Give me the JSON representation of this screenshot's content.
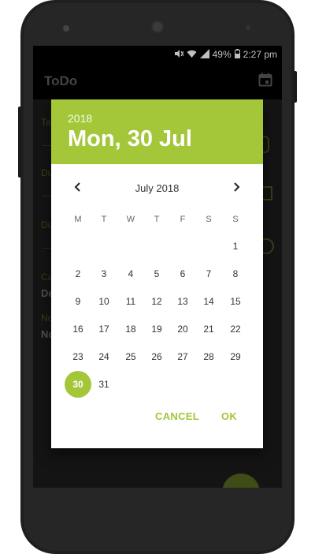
{
  "status_bar": {
    "battery": "49%",
    "time": "2:27 pm"
  },
  "app": {
    "title": "ToDo"
  },
  "background_form": {
    "labels": [
      "Ta",
      "Du",
      "Du",
      "Ca",
      "No"
    ],
    "values": [
      "De",
      "No"
    ]
  },
  "date_picker": {
    "accent_color": "#a4c639",
    "header": {
      "year": "2018",
      "date": "Mon, 30 Jul"
    },
    "month_label": "July 2018",
    "weekdays": [
      "M",
      "T",
      "W",
      "T",
      "F",
      "S",
      "S"
    ],
    "days": [
      "1",
      "2",
      "3",
      "4",
      "5",
      "6",
      "7",
      "8",
      "9",
      "10",
      "11",
      "12",
      "13",
      "14",
      "15",
      "16",
      "17",
      "18",
      "19",
      "20",
      "21",
      "22",
      "23",
      "24",
      "25",
      "26",
      "27",
      "28",
      "29",
      "30",
      "31"
    ],
    "selected_day": "30",
    "cancel_label": "CANCEL",
    "ok_label": "OK"
  }
}
